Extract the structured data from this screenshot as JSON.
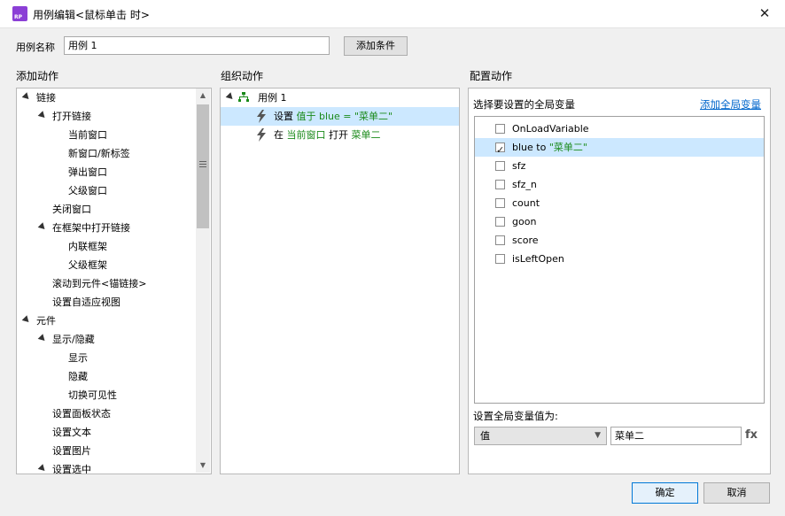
{
  "window": {
    "title": "用例编辑<鼠标单击 时>",
    "icon_text": "RP",
    "close_glyph": "✕"
  },
  "case": {
    "name_label": "用例名称",
    "name_value": "用例 1",
    "add_condition_label": "添加条件"
  },
  "add_actions": {
    "header": "添加动作",
    "items": [
      {
        "label": "链接",
        "level": 0,
        "expanded": true
      },
      {
        "label": "打开链接",
        "level": 1,
        "expanded": true
      },
      {
        "label": "当前窗口",
        "level": 2
      },
      {
        "label": "新窗口/新标签",
        "level": 2
      },
      {
        "label": "弹出窗口",
        "level": 2
      },
      {
        "label": "父级窗口",
        "level": 2
      },
      {
        "label": "关闭窗口",
        "level": 1
      },
      {
        "label": "在框架中打开链接",
        "level": 1,
        "expanded": true
      },
      {
        "label": "内联框架",
        "level": 2
      },
      {
        "label": "父级框架",
        "level": 2
      },
      {
        "label": "滚动到元件<锚链接>",
        "level": 1
      },
      {
        "label": "设置自适应视图",
        "level": 1
      },
      {
        "label": "元件",
        "level": 0,
        "expanded": true
      },
      {
        "label": "显示/隐藏",
        "level": 1,
        "expanded": true
      },
      {
        "label": "显示",
        "level": 2
      },
      {
        "label": "隐藏",
        "level": 2
      },
      {
        "label": "切换可见性",
        "level": 2
      },
      {
        "label": "设置面板状态",
        "level": 1
      },
      {
        "label": "设置文本",
        "level": 1
      },
      {
        "label": "设置图片",
        "level": 1
      },
      {
        "label": "设置选中",
        "level": 1,
        "expanded": true
      }
    ]
  },
  "organize_actions": {
    "header": "组织动作",
    "case_label": "用例 1",
    "actions": [
      {
        "prefix": "设置 ",
        "highlight": "值于 blue = \"菜单二\"",
        "suffix": ""
      },
      {
        "prefix": "在 ",
        "highlight": "当前窗口",
        "suffix": " 打开 ",
        "highlight2": "菜单二"
      }
    ]
  },
  "configure_actions": {
    "header": "配置动作",
    "select_var_label": "选择要设置的全局变量",
    "add_global_var_link": "添加全局变量",
    "variables": [
      {
        "label": "OnLoadVariable",
        "checked": false
      },
      {
        "label": "blue to ",
        "value": "\"菜单二\"",
        "checked": true
      },
      {
        "label": "sfz",
        "checked": false
      },
      {
        "label": "sfz_n",
        "checked": false
      },
      {
        "label": "count",
        "checked": false
      },
      {
        "label": "goon",
        "checked": false
      },
      {
        "label": "score",
        "checked": false
      },
      {
        "label": "isLeftOpen",
        "checked": false
      }
    ],
    "set_value_label": "设置全局变量值为:",
    "value_type": "值",
    "value_input": "菜单二",
    "fx_label": "fx"
  },
  "footer": {
    "ok_label": "确定",
    "cancel_label": "取消"
  },
  "colors": {
    "selection": "#cce8ff",
    "link": "#0066cc",
    "green_text": "#1a8a1a",
    "accent_button_border": "#0078d7"
  }
}
